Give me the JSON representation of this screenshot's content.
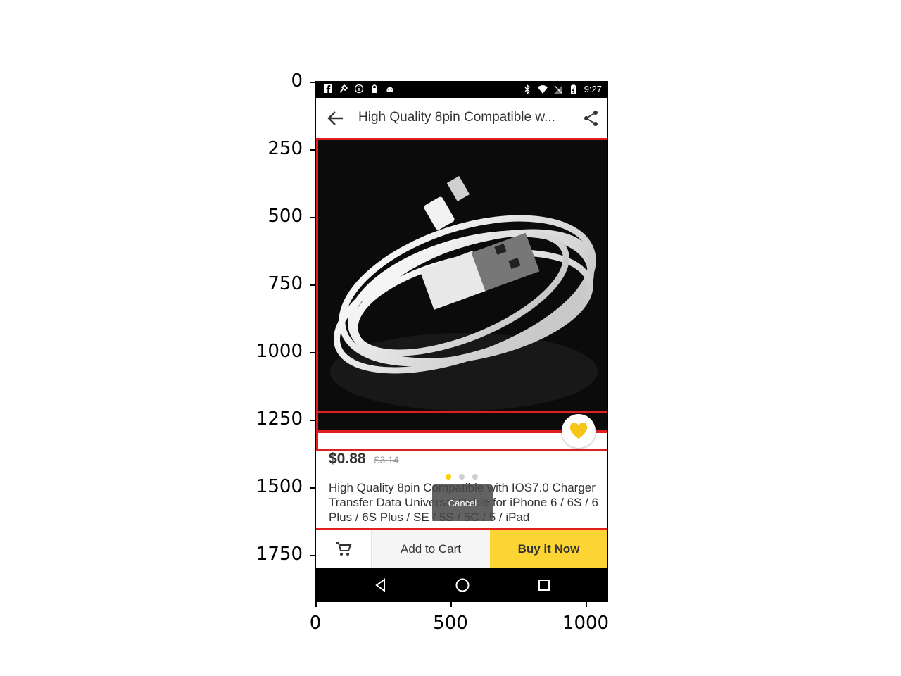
{
  "axes": {
    "y_ticks": [
      "0",
      "250",
      "500",
      "750",
      "1000",
      "1250",
      "1500",
      "1750"
    ],
    "x_ticks": [
      "0",
      "500",
      "1000"
    ]
  },
  "status_bar": {
    "icons": [
      "facebook-icon",
      "satellite-icon",
      "info-icon",
      "lock-icon",
      "android-icon"
    ],
    "right_icons": [
      "bluetooth-icon",
      "wifi-icon",
      "no-signal-icon",
      "battery-icon"
    ],
    "time": "9:27"
  },
  "toolbar": {
    "title": "High Quality  8pin Compatible w..."
  },
  "product": {
    "price": "$0.88",
    "old_price": "$3.14",
    "description": "High Quality  8pin Compatible with IOS7.0 Charger Transfer Data Universal Cable for iPhone 6 / 6S / 6 Plus / 6S Plus / SE / 5S / 5C / 5 / iPad",
    "image_dots": 3,
    "active_dot": 0
  },
  "toast": {
    "label": "Cancel"
  },
  "actions": {
    "add_to_cart": "Add to Cart",
    "buy_now": "Buy it Now"
  },
  "colors": {
    "accent": "#fcd535",
    "highlight": "#e02020",
    "dot_active": "#ffcc00"
  }
}
